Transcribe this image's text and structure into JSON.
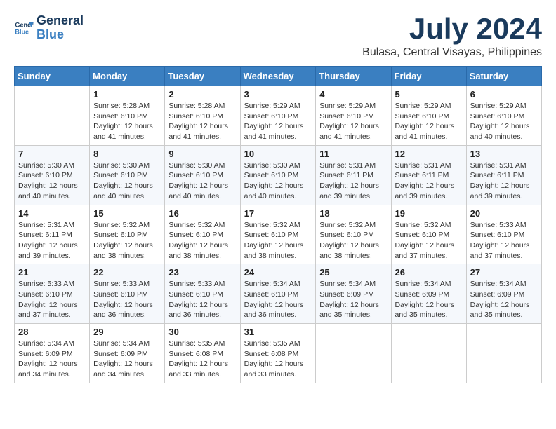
{
  "logo": {
    "line1": "General",
    "line2": "Blue"
  },
  "title": "July 2024",
  "location": "Bulasa, Central Visayas, Philippines",
  "weekdays": [
    "Sunday",
    "Monday",
    "Tuesday",
    "Wednesday",
    "Thursday",
    "Friday",
    "Saturday"
  ],
  "weeks": [
    [
      {
        "day": "",
        "info": ""
      },
      {
        "day": "1",
        "info": "Sunrise: 5:28 AM\nSunset: 6:10 PM\nDaylight: 12 hours\nand 41 minutes."
      },
      {
        "day": "2",
        "info": "Sunrise: 5:28 AM\nSunset: 6:10 PM\nDaylight: 12 hours\nand 41 minutes."
      },
      {
        "day": "3",
        "info": "Sunrise: 5:29 AM\nSunset: 6:10 PM\nDaylight: 12 hours\nand 41 minutes."
      },
      {
        "day": "4",
        "info": "Sunrise: 5:29 AM\nSunset: 6:10 PM\nDaylight: 12 hours\nand 41 minutes."
      },
      {
        "day": "5",
        "info": "Sunrise: 5:29 AM\nSunset: 6:10 PM\nDaylight: 12 hours\nand 41 minutes."
      },
      {
        "day": "6",
        "info": "Sunrise: 5:29 AM\nSunset: 6:10 PM\nDaylight: 12 hours\nand 40 minutes."
      }
    ],
    [
      {
        "day": "7",
        "info": "Sunrise: 5:30 AM\nSunset: 6:10 PM\nDaylight: 12 hours\nand 40 minutes."
      },
      {
        "day": "8",
        "info": "Sunrise: 5:30 AM\nSunset: 6:10 PM\nDaylight: 12 hours\nand 40 minutes."
      },
      {
        "day": "9",
        "info": "Sunrise: 5:30 AM\nSunset: 6:10 PM\nDaylight: 12 hours\nand 40 minutes."
      },
      {
        "day": "10",
        "info": "Sunrise: 5:30 AM\nSunset: 6:10 PM\nDaylight: 12 hours\nand 40 minutes."
      },
      {
        "day": "11",
        "info": "Sunrise: 5:31 AM\nSunset: 6:11 PM\nDaylight: 12 hours\nand 39 minutes."
      },
      {
        "day": "12",
        "info": "Sunrise: 5:31 AM\nSunset: 6:11 PM\nDaylight: 12 hours\nand 39 minutes."
      },
      {
        "day": "13",
        "info": "Sunrise: 5:31 AM\nSunset: 6:11 PM\nDaylight: 12 hours\nand 39 minutes."
      }
    ],
    [
      {
        "day": "14",
        "info": "Sunrise: 5:31 AM\nSunset: 6:11 PM\nDaylight: 12 hours\nand 39 minutes."
      },
      {
        "day": "15",
        "info": "Sunrise: 5:32 AM\nSunset: 6:10 PM\nDaylight: 12 hours\nand 38 minutes."
      },
      {
        "day": "16",
        "info": "Sunrise: 5:32 AM\nSunset: 6:10 PM\nDaylight: 12 hours\nand 38 minutes."
      },
      {
        "day": "17",
        "info": "Sunrise: 5:32 AM\nSunset: 6:10 PM\nDaylight: 12 hours\nand 38 minutes."
      },
      {
        "day": "18",
        "info": "Sunrise: 5:32 AM\nSunset: 6:10 PM\nDaylight: 12 hours\nand 38 minutes."
      },
      {
        "day": "19",
        "info": "Sunrise: 5:32 AM\nSunset: 6:10 PM\nDaylight: 12 hours\nand 37 minutes."
      },
      {
        "day": "20",
        "info": "Sunrise: 5:33 AM\nSunset: 6:10 PM\nDaylight: 12 hours\nand 37 minutes."
      }
    ],
    [
      {
        "day": "21",
        "info": "Sunrise: 5:33 AM\nSunset: 6:10 PM\nDaylight: 12 hours\nand 37 minutes."
      },
      {
        "day": "22",
        "info": "Sunrise: 5:33 AM\nSunset: 6:10 PM\nDaylight: 12 hours\nand 36 minutes."
      },
      {
        "day": "23",
        "info": "Sunrise: 5:33 AM\nSunset: 6:10 PM\nDaylight: 12 hours\nand 36 minutes."
      },
      {
        "day": "24",
        "info": "Sunrise: 5:34 AM\nSunset: 6:10 PM\nDaylight: 12 hours\nand 36 minutes."
      },
      {
        "day": "25",
        "info": "Sunrise: 5:34 AM\nSunset: 6:09 PM\nDaylight: 12 hours\nand 35 minutes."
      },
      {
        "day": "26",
        "info": "Sunrise: 5:34 AM\nSunset: 6:09 PM\nDaylight: 12 hours\nand 35 minutes."
      },
      {
        "day": "27",
        "info": "Sunrise: 5:34 AM\nSunset: 6:09 PM\nDaylight: 12 hours\nand 35 minutes."
      }
    ],
    [
      {
        "day": "28",
        "info": "Sunrise: 5:34 AM\nSunset: 6:09 PM\nDaylight: 12 hours\nand 34 minutes."
      },
      {
        "day": "29",
        "info": "Sunrise: 5:34 AM\nSunset: 6:09 PM\nDaylight: 12 hours\nand 34 minutes."
      },
      {
        "day": "30",
        "info": "Sunrise: 5:35 AM\nSunset: 6:08 PM\nDaylight: 12 hours\nand 33 minutes."
      },
      {
        "day": "31",
        "info": "Sunrise: 5:35 AM\nSunset: 6:08 PM\nDaylight: 12 hours\nand 33 minutes."
      },
      {
        "day": "",
        "info": ""
      },
      {
        "day": "",
        "info": ""
      },
      {
        "day": "",
        "info": ""
      }
    ]
  ]
}
